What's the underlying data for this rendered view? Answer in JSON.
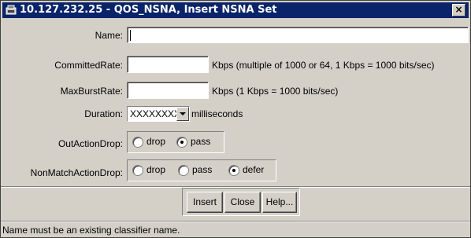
{
  "window": {
    "title": "10.127.232.25 - QOS_NSNA, Insert NSNA Set",
    "close_label": "×",
    "title_icon": "app-window-icon"
  },
  "form": {
    "name": {
      "label": "Name:",
      "value": ""
    },
    "committed_rate": {
      "label": "CommittedRate:",
      "value": "",
      "unit": "Kbps (multiple of 1000 or 64, 1 Kbps = 1000 bits/sec)"
    },
    "max_burst_rate": {
      "label": "MaxBurstRate:",
      "value": "",
      "unit": "Kbps (1 Kbps = 1000 bits/sec)"
    },
    "duration": {
      "label": "Duration:",
      "value": "XXXXXXXX",
      "unit": "milliseconds"
    },
    "out_action_drop": {
      "label": "OutActionDrop:",
      "options": [
        "drop",
        "pass"
      ],
      "selected": "pass"
    },
    "non_match_action_drop": {
      "label": "NonMatchActionDrop:",
      "options": [
        "drop",
        "pass",
        "defer"
      ],
      "selected": "defer"
    }
  },
  "buttons": {
    "insert": "Insert",
    "close": "Close",
    "help": "Help..."
  },
  "status": {
    "message": "Name must be an existing classifier name."
  },
  "colors": {
    "titlebar": "#0a246a",
    "dialog_bg": "#d4d0c8"
  }
}
